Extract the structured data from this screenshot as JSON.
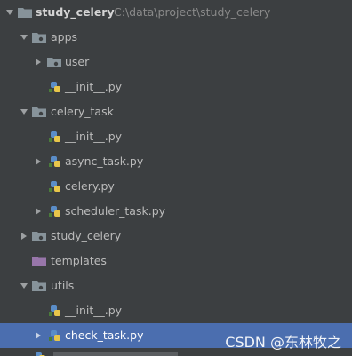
{
  "project": {
    "name": "study_celery",
    "path": "C:\\data\\project\\study_celery"
  },
  "tree": {
    "apps": "apps",
    "user": "user",
    "apps_init": "__init__.py",
    "celery_task": "celery_task",
    "ct_init": "__init__.py",
    "async_task": "async_task.py",
    "celery_py": "celery.py",
    "scheduler_task": "scheduler_task.py",
    "study_celery": "study_celery",
    "templates": "templates",
    "utils": "utils",
    "utils_init": "__init__.py",
    "check_task": "check_task.py"
  },
  "watermark": "CSDN @东林牧之",
  "colors": {
    "background": "#3c3f41",
    "selection": "#4b6eaf",
    "folder": "#87939a",
    "templates_folder": "#9876aa"
  },
  "icons": {
    "folder": "folder-icon",
    "package": "package-folder-icon",
    "python": "python-file-icon",
    "templates": "templates-folder-icon"
  }
}
